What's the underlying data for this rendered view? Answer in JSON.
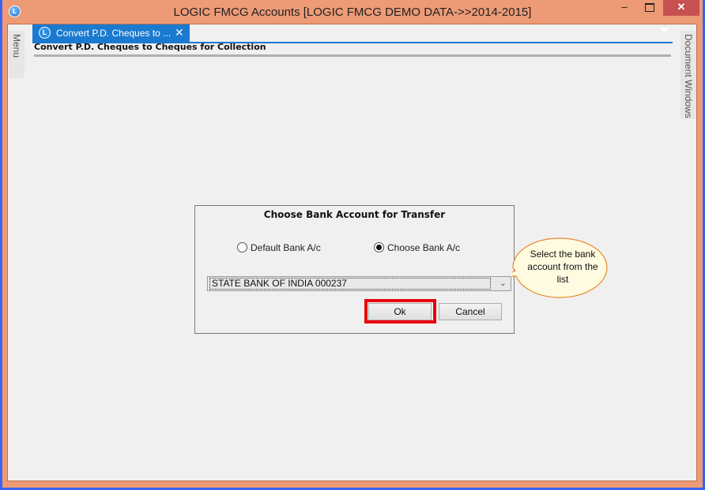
{
  "window": {
    "title": "LOGIC FMCG Accounts  [LOGIC FMCG DEMO DATA->>2014-2015]",
    "app_icon_glyph": "L",
    "minimize_glyph": "–",
    "close_glyph": "✕"
  },
  "side_panels": {
    "left_label": "Menu",
    "right_label": "Document Windows"
  },
  "tabs": [
    {
      "label": "Convert P.D. Cheques to ...",
      "icon_glyph": "L",
      "close_glyph": "✕",
      "active": true
    }
  ],
  "page": {
    "heading": "Convert P.D. Cheques to Cheques for Collection"
  },
  "dialog": {
    "title": "Choose Bank Account for Transfer",
    "radio_options": [
      {
        "label": "Default Bank A/c",
        "checked": false
      },
      {
        "label": "Choose Bank A/c",
        "checked": true
      }
    ],
    "bank_select": {
      "value": "STATE BANK OF INDIA 000237",
      "arrow_glyph": "⌄"
    },
    "ok_label": "Ok",
    "cancel_label": "Cancel"
  },
  "callout": {
    "text": "Select the bank account from the list"
  },
  "colors": {
    "frame": "#ed9a76",
    "outer_border": "#3a64f0",
    "tab_accent": "#1a7ad0",
    "highlight": "#e8000c",
    "callout_fill": "#fffbe0",
    "callout_border": "#e88a2e"
  }
}
